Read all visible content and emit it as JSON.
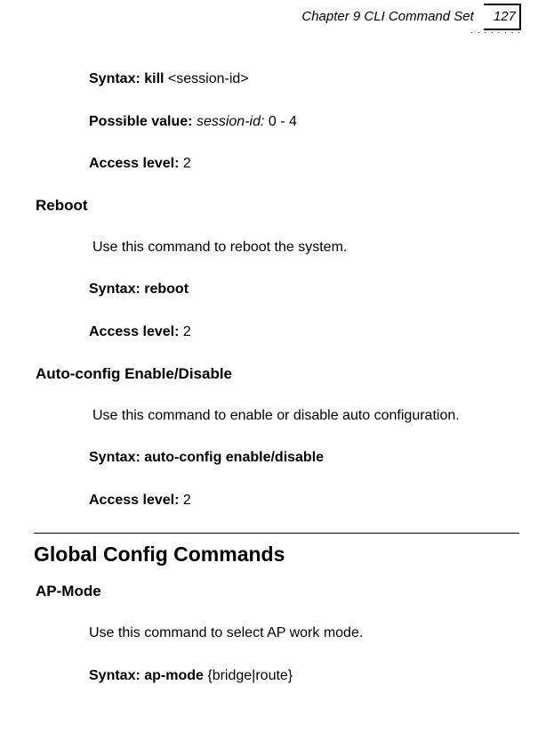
{
  "header": {
    "chapter": "Chapter 9 CLI Command Set",
    "page_number": "127"
  },
  "kill": {
    "syntax_label": "Syntax: kill ",
    "syntax_arg": "<session-id>",
    "possible_value_label": "Possible value:  ",
    "possible_value_name": "session-id: ",
    "possible_value_range": "0 - 4",
    "access_level_label": "Access level: ",
    "access_level_value": "2"
  },
  "reboot": {
    "heading": "Reboot",
    "desc": " Use this command to reboot the system.",
    "syntax_label": "Syntax: reboot",
    "access_level_label": "Access level: ",
    "access_level_value": "2"
  },
  "autoconfig": {
    "heading": "Auto-config Enable/Disable",
    "desc": " Use this command to enable or disable auto configuration.",
    "syntax_label": "Syntax: auto-config enable/disable",
    "access_level_label": "Access level: ",
    "access_level_value": "2"
  },
  "global": {
    "heading": "Global Config Commands"
  },
  "apmode": {
    "heading": "AP-Mode",
    "desc": "Use this command to select AP work mode.",
    "syntax_label": "Syntax: ap-mode  ",
    "syntax_arg": "{bridge|route}"
  }
}
